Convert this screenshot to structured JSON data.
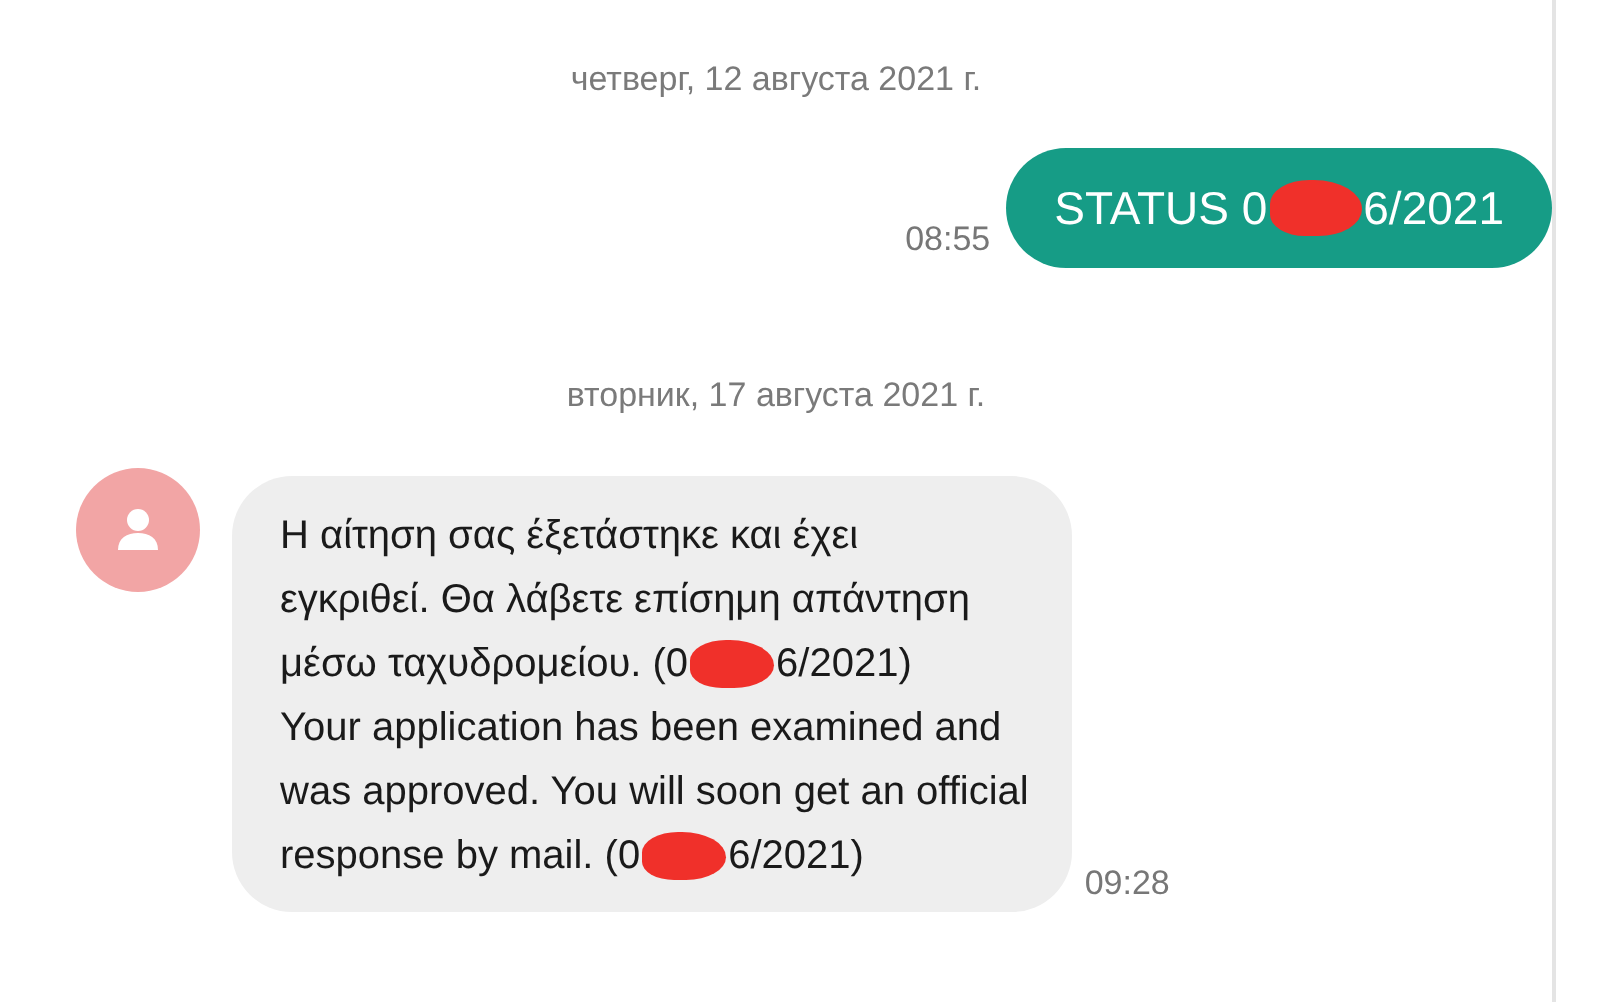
{
  "conversation": [
    {
      "kind": "date",
      "text": "четверг, 12 августа 2021 г."
    },
    {
      "kind": "outgoing",
      "time": "08:55",
      "lines": [
        [
          {
            "kind": "text",
            "text": "STATUS 0"
          },
          {
            "kind": "redacted"
          },
          {
            "kind": "text",
            "text": "6/2021"
          }
        ]
      ]
    },
    {
      "kind": "date",
      "text": "вторник, 17 августа 2021 г."
    },
    {
      "kind": "incoming",
      "time": "09:28",
      "lines": [
        [
          {
            "kind": "text",
            "text": "Η αίτηση σας έξετάστηκε και έχει"
          }
        ],
        [
          {
            "kind": "text",
            "text": "εγκριθεί. Θα λάβετε επίσημη απάντηση"
          }
        ],
        [
          {
            "kind": "text",
            "text": "μέσω ταχυδρομείου. (0"
          },
          {
            "kind": "redacted"
          },
          {
            "kind": "text",
            "text": "6/2021)"
          }
        ],
        [
          {
            "kind": "text",
            "text": "Your application has been examined and"
          }
        ],
        [
          {
            "kind": "text",
            "text": "was approved. You will soon get an official"
          }
        ],
        [
          {
            "kind": "text",
            "text": "response by mail. (0"
          },
          {
            "kind": "redacted"
          },
          {
            "kind": "text",
            "text": "6/2021)"
          }
        ]
      ]
    }
  ]
}
